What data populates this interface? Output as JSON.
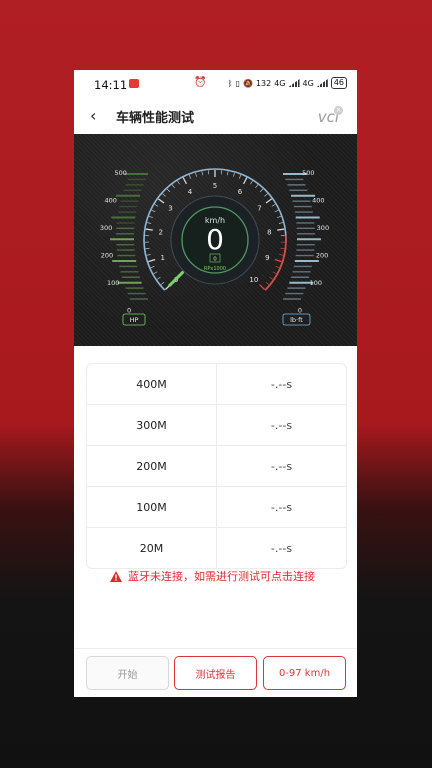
{
  "status": {
    "time": "14:11",
    "speed": "132",
    "net": "4G",
    "net2": "4G",
    "battery": "46"
  },
  "header": {
    "title": "车辆性能测试",
    "logo": "vci"
  },
  "gauge": {
    "unit": "km/h",
    "speed": "0",
    "rpm_value": "0",
    "rpm_label": "RPx1000",
    "rpm_ticks": [
      "0",
      "1",
      "2",
      "3",
      "4",
      "5",
      "6",
      "7",
      "8",
      "9",
      "10"
    ],
    "hp_label": "HP",
    "hp_ticks": [
      "500",
      "400",
      "300",
      "200",
      "100",
      "0"
    ],
    "torque_label": "lb·ft",
    "torque_ticks": [
      "500",
      "400",
      "300",
      "200",
      "100",
      "0"
    ],
    "rpm_level": 0,
    "colors": {
      "accent": "#7bd16a",
      "redline": "#e0483a",
      "ring": "#8fb8d8"
    }
  },
  "results": [
    {
      "distance": "400M",
      "time": "-.--s"
    },
    {
      "distance": "300M",
      "time": "-.--s"
    },
    {
      "distance": "200M",
      "time": "-.--s"
    },
    {
      "distance": "100M",
      "time": "-.--s"
    },
    {
      "distance": "20M",
      "time": "-.--s"
    }
  ],
  "warning": {
    "text": "蓝牙未连接，如需进行测试可点击连接",
    "icon": "warning-icon",
    "color": "#e5282f"
  },
  "actions": {
    "start": "开始",
    "report": "测试报告",
    "range": "0-97 km/h"
  }
}
